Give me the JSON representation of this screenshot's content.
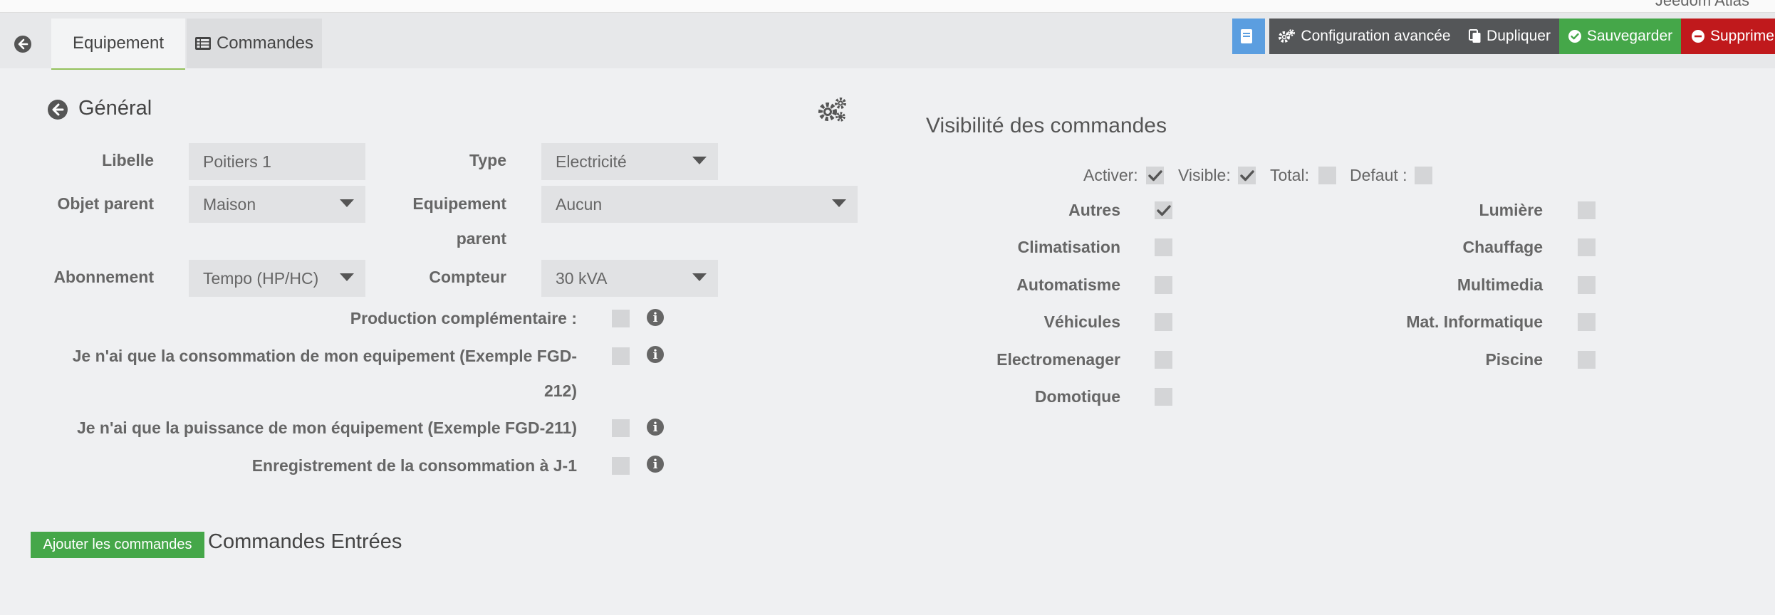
{
  "app_header": {
    "user_text": "Jeedom Atlas"
  },
  "tabs": [
    {
      "label": "Equipement"
    },
    {
      "label": "Commandes"
    }
  ],
  "toolbar": {
    "config_label": "Configuration avancée",
    "duplicate_label": "Dupliquer",
    "save_label": "Sauvegarder",
    "delete_label": "Supprimer",
    "colors": {
      "doc": "#5b9ee0",
      "config": "#545658",
      "save": "#45a749",
      "delete": "#c0191c"
    }
  },
  "general": {
    "title": "Général",
    "libelle_label": "Libelle",
    "libelle_value": "Poitiers 1",
    "type_label": "Type",
    "type_value": "Electricité",
    "parent_object_label": "Objet parent",
    "parent_object_value": "Maison",
    "parent_equipment_label_1": "Equipement",
    "parent_equipment_label_2": "parent",
    "parent_equipment_value": "Aucun",
    "subscription_label": "Abonnement",
    "subscription_value": "Tempo (HP/HC)",
    "meter_label": "Compteur",
    "meter_value": "30 kVA",
    "options": [
      {
        "label": "Production complémentaire :",
        "checked": false
      },
      {
        "label_1": "Je n'ai que la consommation de mon equipement (Exemple FGD-",
        "label_2": "212)",
        "checked": false
      },
      {
        "label": "Je n'ai que la puissance de mon équipement (Exemple FGD-211)",
        "checked": false
      },
      {
        "label": "Enregistrement de la consommation à J-1",
        "checked": false
      }
    ]
  },
  "visibility": {
    "title": "Visibilité des commandes",
    "header": {
      "activer": "Activer:",
      "activer_checked": true,
      "visible": "Visible:",
      "visible_checked": true,
      "total": "Total:",
      "total_checked": false,
      "defaut": "Defaut :",
      "defaut_checked": false
    },
    "left": [
      {
        "label": "Autres",
        "checked": true
      },
      {
        "label": "Climatisation",
        "checked": false
      },
      {
        "label": "Automatisme",
        "checked": false
      },
      {
        "label": "Véhicules",
        "checked": false
      },
      {
        "label": "Electromenager",
        "checked": false
      },
      {
        "label": "Domotique",
        "checked": false
      }
    ],
    "right": [
      {
        "label": "Lumière",
        "checked": false
      },
      {
        "label": "Chauffage",
        "checked": false
      },
      {
        "label": "Multimedia",
        "checked": false
      },
      {
        "label": "Mat. Informatique",
        "checked": false
      },
      {
        "label": "Piscine",
        "checked": false
      }
    ]
  },
  "commands": {
    "add_button": "Ajouter les commandes",
    "section_title": "Commandes Entrées"
  }
}
